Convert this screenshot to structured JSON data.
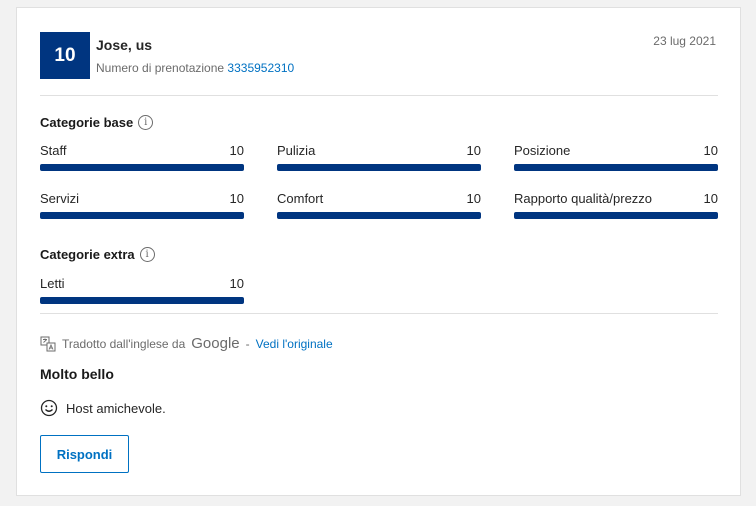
{
  "review": {
    "score": "10",
    "reviewer": "Jose, us",
    "booking_label": "Numero di prenotazione",
    "booking_number": "3335952310",
    "date": "23 lug 2021"
  },
  "base_categories": {
    "title": "Categorie base",
    "info_icon": "i",
    "items": [
      {
        "label": "Staff",
        "value": "10",
        "fraction": 1.0
      },
      {
        "label": "Pulizia",
        "value": "10",
        "fraction": 1.0
      },
      {
        "label": "Posizione",
        "value": "10",
        "fraction": 1.0
      },
      {
        "label": "Servizi",
        "value": "10",
        "fraction": 1.0
      },
      {
        "label": "Comfort",
        "value": "10",
        "fraction": 1.0
      },
      {
        "label": "Rapporto qualità/prezzo",
        "value": "10",
        "fraction": 1.0
      }
    ]
  },
  "extra_categories": {
    "title": "Categorie extra",
    "info_icon": "i",
    "items": [
      {
        "label": "Letti",
        "value": "10",
        "fraction": 1.0
      }
    ]
  },
  "translation": {
    "text": "Tradotto dall'inglese da",
    "provider": "Google",
    "separator": "-",
    "link": "Vedi l'originale"
  },
  "content": {
    "title": "Molto bello",
    "positive_text": "Host amichevole."
  },
  "actions": {
    "reply_label": "Rispondi"
  },
  "colors": {
    "brand": "#003580",
    "link": "#0071c2"
  },
  "icons": {
    "translate": "translate-icon",
    "smiley": "smiley-icon",
    "info": "info-icon"
  }
}
